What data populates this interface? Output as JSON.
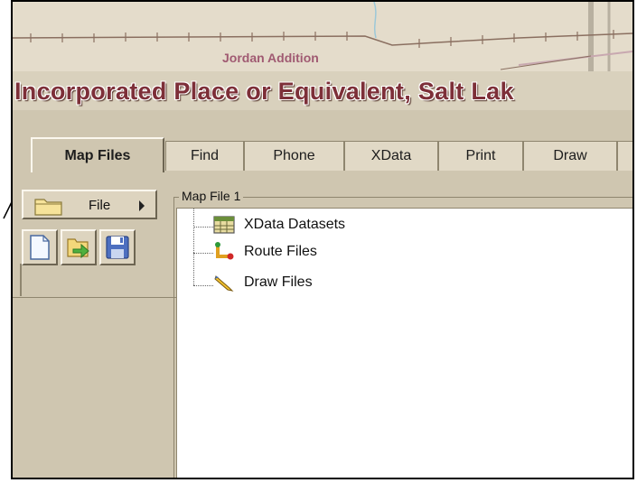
{
  "map": {
    "place_label": "Jordan Addition",
    "layer_label": "Incorporated Place or Equivalent, Salt Lak"
  },
  "tabs": [
    {
      "label": "Map Files",
      "active": true
    },
    {
      "label": "Find",
      "active": false
    },
    {
      "label": "Phone",
      "active": false
    },
    {
      "label": "XData",
      "active": false
    },
    {
      "label": "Print",
      "active": false
    },
    {
      "label": "Draw",
      "active": false
    }
  ],
  "left_panel": {
    "file_button": {
      "label": "File",
      "icon": "folder-icon"
    },
    "toolbar": [
      {
        "name": "new-file-button",
        "icon": "new-document-icon"
      },
      {
        "name": "open-file-button",
        "icon": "open-arrow-icon"
      },
      {
        "name": "save-file-button",
        "icon": "floppy-disk-icon"
      }
    ]
  },
  "map_file": {
    "group_label": "Map File 1",
    "tree": [
      {
        "label": "XData Datasets",
        "icon": "dataset-grid-icon"
      },
      {
        "label": "Route Files",
        "icon": "route-icon"
      },
      {
        "label": "Draw Files",
        "icon": "pencil-icon"
      }
    ]
  },
  "colors": {
    "panel_bg": "#cfc6b0",
    "map_layer_text": "#7d2f38",
    "place_text": "#a05a72"
  }
}
